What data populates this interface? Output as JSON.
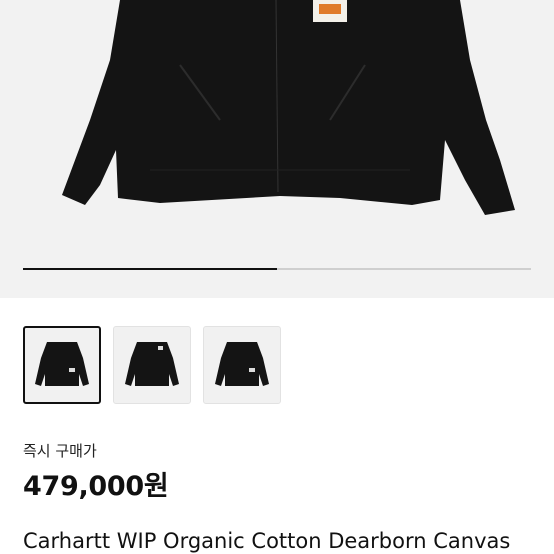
{
  "product": {
    "images": [
      {
        "alt": "black canvas jacket front",
        "selected": true
      },
      {
        "alt": "black canvas jacket front",
        "selected": false
      },
      {
        "alt": "black canvas jacket front",
        "selected": false
      }
    ],
    "gallery_progress": 0.5,
    "purchase_label": "즉시 구매가",
    "price": "479,000원",
    "title": "Carhartt WIP Organic Cotton Dearborn Canvas"
  },
  "colors": {
    "jacket": "#141414",
    "hero_bg": "#f2f2f2",
    "label_orange": "#e07b2b"
  }
}
